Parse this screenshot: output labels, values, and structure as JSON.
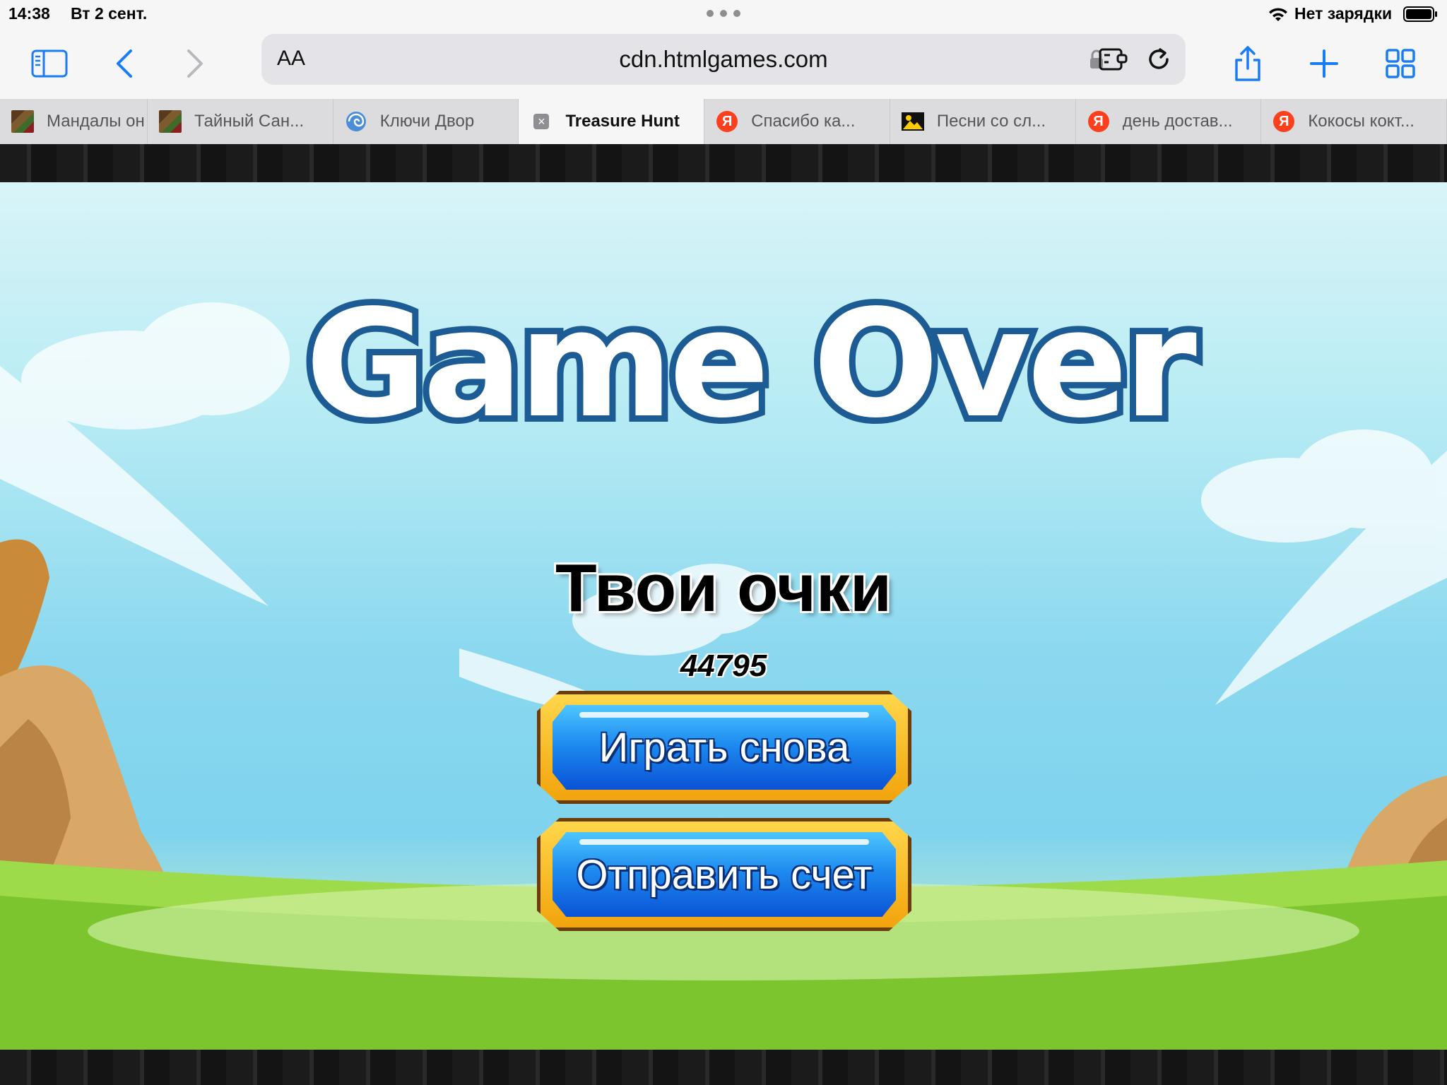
{
  "status_bar": {
    "time": "14:38",
    "date": "Вт 2 сент.",
    "charging": "Нет зарядки"
  },
  "toolbar": {
    "text_size_label": "AA",
    "url": "cdn.htmlgames.com"
  },
  "tabs": [
    {
      "title": "Мандалы он",
      "favicon": "pixel-icon"
    },
    {
      "title": "Тайный Сан...",
      "favicon": "pixel-icon"
    },
    {
      "title": "Ключи Двор",
      "favicon": "globe-icon"
    },
    {
      "title": "Treasure Hunt",
      "favicon": "close-icon",
      "active": true
    },
    {
      "title": "Спасибо ка...",
      "favicon": "yandex-icon"
    },
    {
      "title": "Песни со сл...",
      "favicon": "image-icon"
    },
    {
      "title": "день достав...",
      "favicon": "yandex-icon"
    },
    {
      "title": "Кокосы кокт...",
      "favicon": "yandex-icon"
    }
  ],
  "game": {
    "title": "Game Over",
    "score_label": "Твои очки",
    "score_value": "44795",
    "play_again_label": "Играть снова",
    "submit_score_label": "Отправить счет"
  },
  "colors": {
    "accent": "#007aff",
    "sky_top": "#d9f4f8",
    "sky_bottom": "#7fd3ee",
    "grass": "#8ed34d",
    "button_blue": "#1e8cf0",
    "button_gold": "#ffd64a",
    "title_outline": "#1d5b94"
  }
}
